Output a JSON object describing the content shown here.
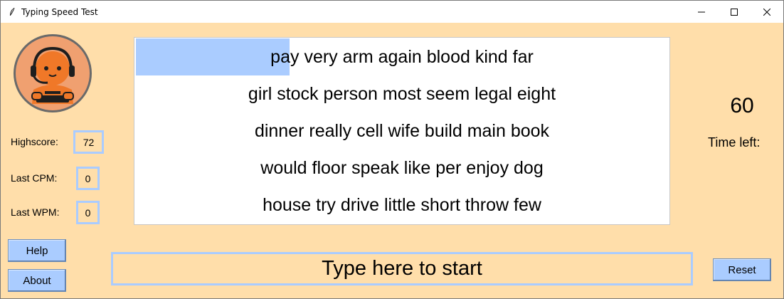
{
  "window": {
    "title": "Typing Speed Test",
    "icon": "feather-icon"
  },
  "stats": {
    "highscore_label": "Highscore:",
    "highscore_value": "72",
    "last_cpm_label": "Last CPM:",
    "last_cpm_value": "0",
    "last_wpm_label": "Last WPM:",
    "last_wpm_value": "0"
  },
  "buttons": {
    "help": "Help",
    "about": "About",
    "reset": "Reset"
  },
  "text_panel": {
    "current_word": "pay",
    "lines": [
      "very arm again blood kind far",
      "girl stock person most seem legal eight",
      "dinner really cell wife build main book",
      "would floor speak like per enjoy dog",
      "house try drive little short throw few"
    ]
  },
  "timer": {
    "value": "60",
    "label": "Time left:"
  },
  "entry": {
    "value": "Type here to start"
  },
  "colors": {
    "background": "#FFDEAA",
    "accent": "#AACCFF",
    "panel": "#FFFFFF"
  }
}
